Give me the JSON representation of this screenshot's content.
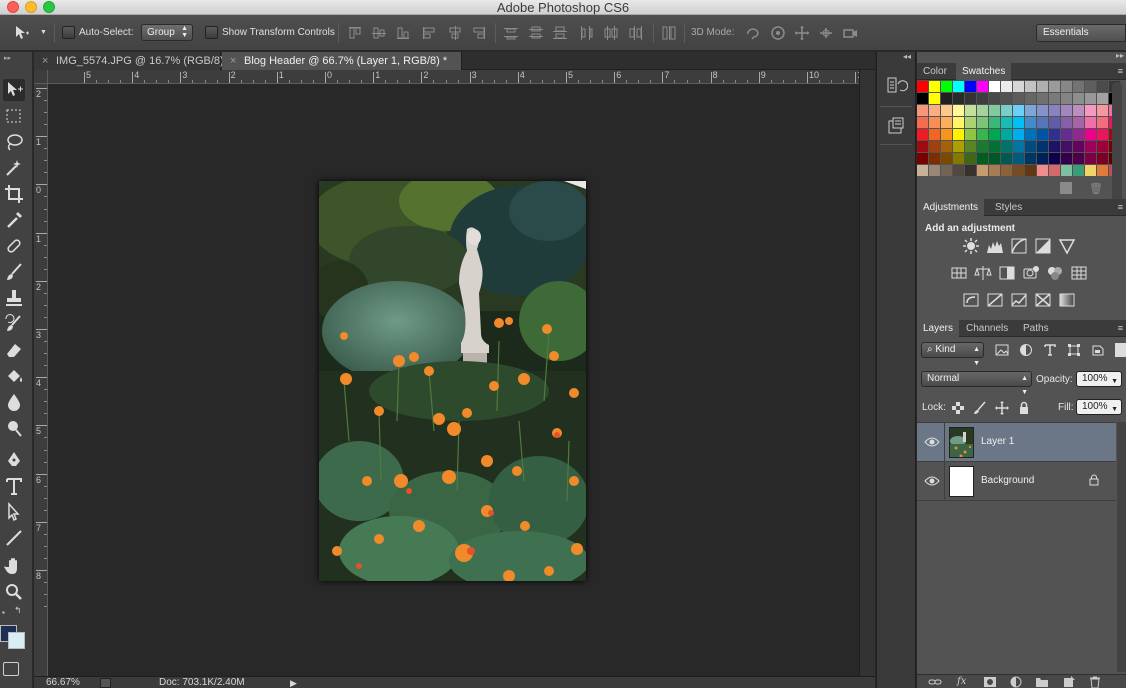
{
  "app": {
    "title": "Adobe Photoshop CS6"
  },
  "options_bar": {
    "auto_select_label": "Auto-Select:",
    "auto_select_checked": false,
    "auto_select_mode": "Group",
    "show_transform_label": "Show Transform Controls",
    "show_transform_checked": false,
    "mode_3d_label": "3D Mode:",
    "workspace": "Essentials"
  },
  "tabs": [
    {
      "label": "IMG_5574.JPG @ 16.7% (RGB/8)",
      "active": false
    },
    {
      "label": "Blog Header @ 66.7% (Layer 1, RGB/8) *",
      "active": true
    }
  ],
  "rulers": {
    "horizontal": [
      "5",
      "4",
      "3",
      "2",
      "1",
      "0",
      "1",
      "2",
      "3",
      "4",
      "5",
      "6",
      "7",
      "8",
      "9",
      "10",
      "1"
    ],
    "vertical": [
      "2",
      "1",
      "0",
      "1",
      "2",
      "3",
      "4",
      "5",
      "6",
      "7",
      "8"
    ]
  },
  "colors": {
    "foreground": "#1d2f52",
    "background": "#d7eef5",
    "selected_layer": "#6b7686"
  },
  "status": {
    "zoom": "66.67%",
    "doc": "Doc: 703.1K/2.40M"
  },
  "panels": {
    "color_tabs": [
      "Color",
      "Swatches"
    ],
    "active_color_tab": "Swatches",
    "adjust_tabs": [
      "Adjustments",
      "Styles"
    ],
    "adjust_title": "Add an adjustment",
    "layer_tabs": [
      "Layers",
      "Channels",
      "Paths"
    ],
    "kind_filter": "Kind",
    "blend_mode": "Normal",
    "opacity_label": "Opacity:",
    "opacity": "100%",
    "lock_label": "Lock:",
    "fill_label": "Fill:",
    "fill": "100%"
  },
  "layers": [
    {
      "name": "Layer 1",
      "selected": true,
      "visible": true,
      "locked": false
    },
    {
      "name": "Background",
      "selected": false,
      "visible": true,
      "locked": true
    }
  ],
  "swatches": [
    [
      "#ff0000",
      "#ffff00",
      "#00ff00",
      "#00ffff",
      "#0000ff",
      "#ff00ff",
      "#ffffff",
      "#ebebeb",
      "#d7d7d7",
      "#c3c3c3",
      "#afafaf",
      "#9b9b9b",
      "#878787",
      "#737373",
      "#5f5f5f",
      "#4b4b4b",
      "#373737"
    ],
    [
      "#000000",
      "#ffff00",
      "#202020",
      "#2a2a2a",
      "#343434",
      "#3e3e3e",
      "#484848",
      "#525252",
      "#5c5c5c",
      "#666666",
      "#707070",
      "#7a7a7a",
      "#848484",
      "#8e8e8e",
      "#989898",
      "#a2a2a2",
      "#000000"
    ],
    [
      "#f7977a",
      "#f9ad81",
      "#fdc68a",
      "#fff79a",
      "#c4df9b",
      "#a3d39c",
      "#82ca9d",
      "#7bcdc8",
      "#6ecff6",
      "#7ea7d8",
      "#8493ca",
      "#8882be",
      "#a187be",
      "#bc8dbf",
      "#f49ac2",
      "#f6989d",
      "#f06eaa"
    ],
    [
      "#f26c4f",
      "#f68e55",
      "#fbaf5c",
      "#fff467",
      "#acd372",
      "#7cc576",
      "#3bb878",
      "#1abbb4",
      "#00bff3",
      "#438ccb",
      "#5574b9",
      "#605ca8",
      "#855fa8",
      "#a763a8",
      "#f06eaa",
      "#f26d7d",
      "#ed145b"
    ],
    [
      "#ed1c24",
      "#f26522",
      "#f7941d",
      "#fff200",
      "#8dc73f",
      "#39b54a",
      "#00a651",
      "#00a99d",
      "#00aeef",
      "#0072bc",
      "#0054a6",
      "#2e3192",
      "#662d91",
      "#92278f",
      "#ec008c",
      "#ed145b",
      "#9e0b0f"
    ],
    [
      "#9e0b0f",
      "#a0410d",
      "#a36209",
      "#aba000",
      "#598527",
      "#1a7b30",
      "#007236",
      "#00746b",
      "#0076a3",
      "#004b80",
      "#003471",
      "#1b1464",
      "#440e62",
      "#630460",
      "#9e005d",
      "#9e0039",
      "#790000"
    ],
    [
      "#790000",
      "#7b2e00",
      "#7d4900",
      "#827b00",
      "#406618",
      "#005e20",
      "#005826",
      "#005952",
      "#005b7f",
      "#003663",
      "#002157",
      "#0d004c",
      "#32004b",
      "#4b0049",
      "#7b0046",
      "#7a0026",
      "#5a0000"
    ],
    [
      "#c7b299",
      "#998675",
      "#736357",
      "#534741",
      "#37302d",
      "#c69c6e",
      "#a67c52",
      "#8c6239",
      "#754c24",
      "#603913",
      "#ef8c8c",
      "#d3696b",
      "#7dbfa0",
      "#3b9c7a",
      "#f2d367",
      "#e07b39",
      "#c44d58"
    ]
  ]
}
